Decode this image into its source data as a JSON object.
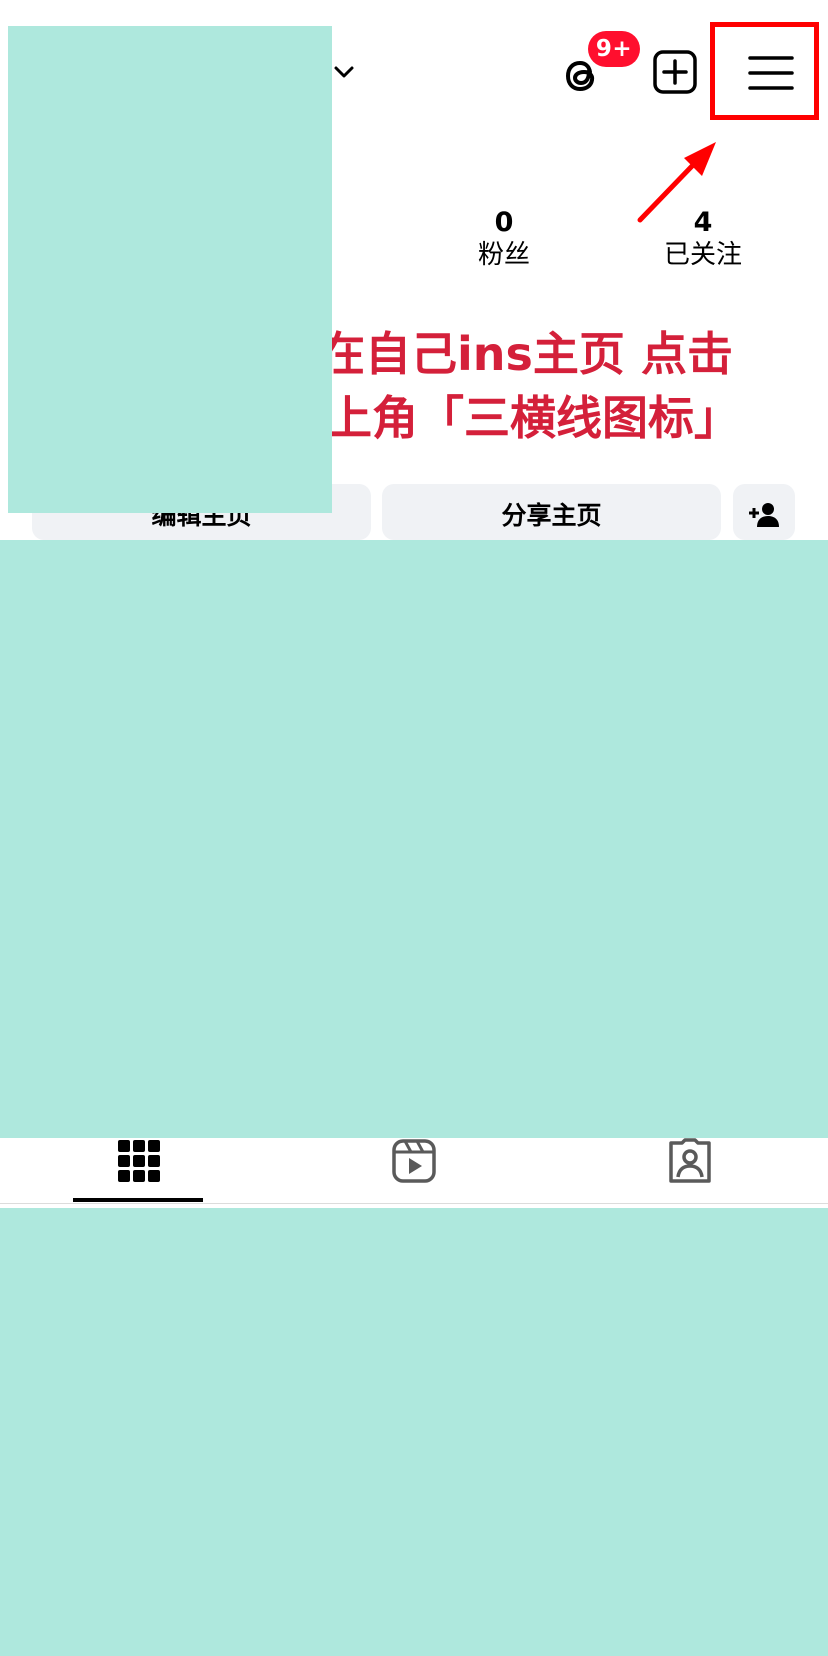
{
  "header": {
    "account_dropdown_icon": "chevron-down-icon",
    "threads_icon": "threads-icon",
    "threads_badge": "9+",
    "create_icon": "plus-square-icon",
    "menu_icon": "hamburger-menu-icon"
  },
  "stats": {
    "followers": {
      "value": "0",
      "label": "粉丝"
    },
    "following": {
      "value": "4",
      "label": "已关注"
    }
  },
  "annotation": {
    "line1": "在自己ins主页  点击",
    "line2": "右上角「三横线图标」",
    "color": "#d4203a",
    "highlight_color": "#ff0000"
  },
  "buttons": {
    "edit_profile": "编辑主页",
    "share_profile": "分享主页",
    "add_person_icon": "add-person-icon"
  },
  "tabs": [
    {
      "name": "posts",
      "icon": "grid-icon",
      "selected": true
    },
    {
      "name": "reels",
      "icon": "reels-icon",
      "selected": false
    },
    {
      "name": "tagged",
      "icon": "tagged-person-icon",
      "selected": false
    }
  ],
  "colors": {
    "redaction": "#aee8dd",
    "badge": "#ff0f2e",
    "button_bg": "#f0f2f5"
  }
}
